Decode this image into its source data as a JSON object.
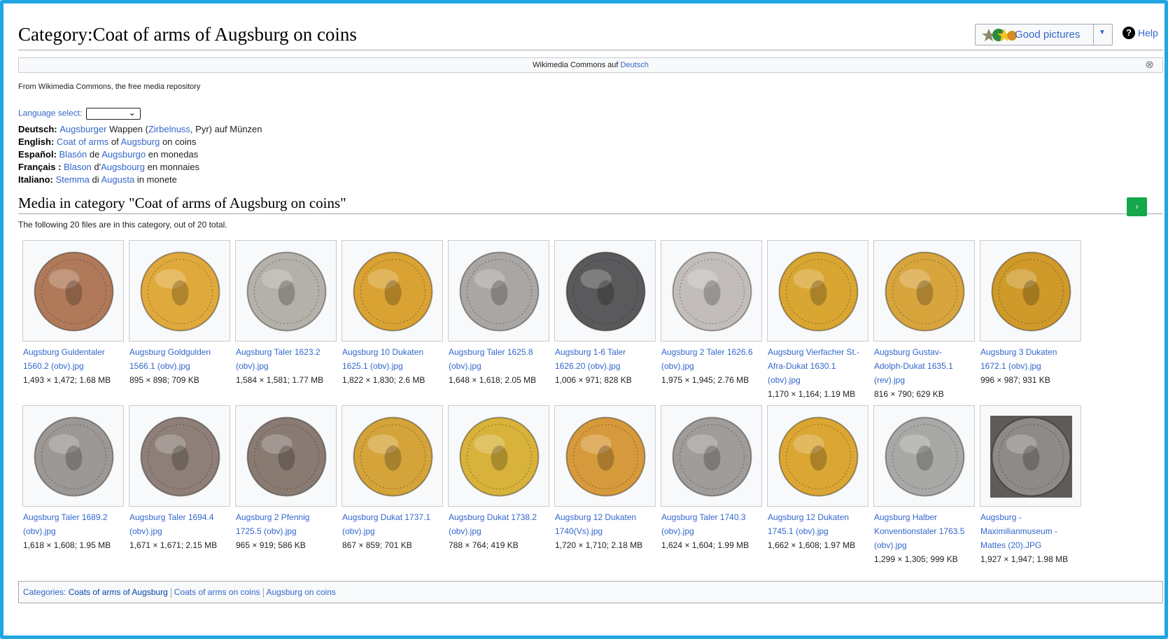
{
  "page": {
    "title": "Category:Coat of arms of Augsburg on coins",
    "good_pictures_label": "Good pictures",
    "help_label": "Help",
    "notice_text": "Wikimedia Commons auf ",
    "notice_link": "Deutsch",
    "tagline": "From Wikimedia Commons, the free media repository",
    "language_select_label": "Language select:"
  },
  "languages": [
    {
      "name": "Deutsch:",
      "parts": [
        [
          "l",
          "Augsburger"
        ],
        [
          "t",
          " Wappen ("
        ],
        [
          "l",
          "Zirbelnuss"
        ],
        [
          "t",
          ", Pyr) auf Münzen"
        ]
      ]
    },
    {
      "name": "English:",
      "parts": [
        [
          "l",
          "Coat of arms"
        ],
        [
          "t",
          " of "
        ],
        [
          "l",
          "Augsburg"
        ],
        [
          "t",
          " on coins"
        ]
      ]
    },
    {
      "name": "Español:",
      "parts": [
        [
          "l",
          "Blasón"
        ],
        [
          "t",
          " de "
        ],
        [
          "l",
          "Augsburgo"
        ],
        [
          "t",
          " en monedas"
        ]
      ]
    },
    {
      "name": "Français :",
      "parts": [
        [
          "l",
          "Blason"
        ],
        [
          "t",
          " d'"
        ],
        [
          "l",
          "Augsbourg"
        ],
        [
          "t",
          " en monnaies"
        ]
      ]
    },
    {
      "name": "Italiano:",
      "parts": [
        [
          "l",
          "Stemma"
        ],
        [
          "t",
          " di "
        ],
        [
          "l",
          "Augusta"
        ],
        [
          "t",
          " in monete"
        ]
      ]
    }
  ],
  "media": {
    "heading": "Media in category \"Coat of arms of Augsburg on coins\"",
    "count_text": "The following 20 files are in this category, out of 20 total.",
    "next_button": "›"
  },
  "files": [
    {
      "name": [
        "Augsburg Guldentaler",
        "1560.2 (obv).jpg"
      ],
      "size": "1,493 × 1,472; 1.68 MB",
      "color": "#b07a5a"
    },
    {
      "name": [
        "Augsburg Goldgulden",
        "1566.1 (obv).jpg"
      ],
      "size": "895 × 898; 709 KB",
      "color": "#e0a93c"
    },
    {
      "name": [
        "Augsburg Taler 1623.2",
        "(obv).jpg"
      ],
      "size": "1,584 × 1,581; 1.77 MB",
      "color": "#b4b0aa"
    },
    {
      "name": [
        "Augsburg 10 Dukaten",
        "1625.1 (obv).jpg"
      ],
      "size": "1,822 × 1,830; 2.6 MB",
      "color": "#d9a233"
    },
    {
      "name": [
        "Augsburg Taler 1625.8",
        "(obv).jpg"
      ],
      "size": "1,648 × 1,618; 2.05 MB",
      "color": "#a9a6a3"
    },
    {
      "name": [
        "Augsburg 1-6 Taler",
        "1626.20 (obv).jpg"
      ],
      "size": "1,006 × 971; 828 KB",
      "color": "#5a5a5c"
    },
    {
      "name": [
        "Augsburg 2 Taler 1626.6",
        "(obv).jpg"
      ],
      "size": "1,975 × 1,945; 2.76 MB",
      "color": "#c2bdbb"
    },
    {
      "name": [
        "Augsburg Vierfacher St.-",
        "Afra-Dukat 1630.1",
        "(obv).jpg"
      ],
      "size": "1,170 × 1,164; 1.19 MB",
      "color": "#d9a632"
    },
    {
      "name": [
        "Augsburg Gustav-",
        "Adolph-Dukat 1635.1",
        "(rev).jpg"
      ],
      "size": "816 × 790; 629 KB",
      "color": "#d8a53d"
    },
    {
      "name": [
        "Augsburg 3 Dukaten",
        "1672.1 (obv).jpg"
      ],
      "size": "996 × 987; 931 KB",
      "color": "#cf9a2a"
    },
    {
      "name": [
        "Augsburg Taler 1689.2",
        "(obv).jpg"
      ],
      "size": "1,618 × 1,608; 1.95 MB",
      "color": "#9c9896"
    },
    {
      "name": [
        "Augsburg Taler 1694.4",
        "(obv).jpg"
      ],
      "size": "1,671 × 1,671; 2.15 MB",
      "color": "#8e7f78"
    },
    {
      "name": [
        "Augsburg 2 Pfennig",
        "1725.5 (obv).jpg"
      ],
      "size": "965 × 919; 586 KB",
      "color": "#8a7b72"
    },
    {
      "name": [
        "Augsburg Dukat 1737.1",
        "(obv).jpg"
      ],
      "size": "867 × 859; 701 KB",
      "color": "#d4a43a"
    },
    {
      "name": [
        "Augsburg Dukat 1738.2",
        "(obv).jpg"
      ],
      "size": "788 × 764; 419 KB",
      "color": "#d8b23a"
    },
    {
      "name": [
        "Augsburg 12 Dukaten",
        "1740(Vs).jpg"
      ],
      "size": "1,720 × 1,710; 2.18 MB",
      "color": "#d69a3c"
    },
    {
      "name": [
        "Augsburg Taler 1740.3",
        "(obv).jpg"
      ],
      "size": "1,624 × 1,604; 1.99 MB",
      "color": "#a09c9a"
    },
    {
      "name": [
        "Augsburg 12 Dukaten",
        "1745.1 (obv).jpg"
      ],
      "size": "1,662 × 1,608; 1.97 MB",
      "color": "#dba633"
    },
    {
      "name": [
        "Augsburg Halber",
        "Konventionstaler 1763.5",
        "(obv).jpg"
      ],
      "size": "1,299 × 1,305; 999 KB",
      "color": "#a8a8a6"
    },
    {
      "name": [
        "Augsburg -",
        "Maximilianmuseum -",
        "Mattes (20).JPG"
      ],
      "size": "1,927 × 1,947; 1.98 MB",
      "color": "#8d8b88"
    }
  ],
  "categories": {
    "label": "Categories: ",
    "items": [
      "Coats of arms of Augsburg",
      "Coats of arms on coins",
      "Augsburg on coins"
    ]
  }
}
